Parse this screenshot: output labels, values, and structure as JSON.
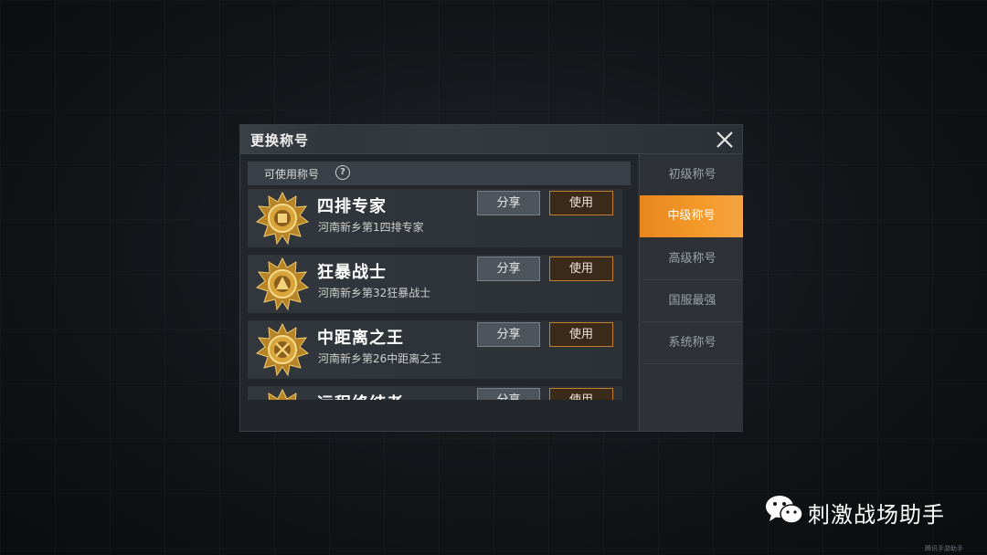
{
  "dialog": {
    "title": "更换称号",
    "subheader": "可使用称号",
    "titles": [
      {
        "name": "四排专家",
        "desc": "河南新乡第1四排专家",
        "share": "分享",
        "use": "使用"
      },
      {
        "name": "狂暴战士",
        "desc": "河南新乡第32狂暴战士",
        "share": "分享",
        "use": "使用"
      },
      {
        "name": "中距离之王",
        "desc": "河南新乡第26中距离之王",
        "share": "分享",
        "use": "使用"
      },
      {
        "name": "远程终结者",
        "desc": "",
        "share": "分享",
        "use": "使用"
      }
    ],
    "tabs": [
      {
        "label": "初级称号",
        "active": false
      },
      {
        "label": "中级称号",
        "active": true
      },
      {
        "label": "高级称号",
        "active": false
      },
      {
        "label": "国服最强",
        "active": false
      },
      {
        "label": "系统称号",
        "active": false
      }
    ]
  },
  "watermark": {
    "text": "刺激战场助手",
    "small": "腾讯手游助手"
  },
  "colors": {
    "accent": "#f09222",
    "use_border": "#c77d2a",
    "badge_gold": "#d9a43a"
  }
}
